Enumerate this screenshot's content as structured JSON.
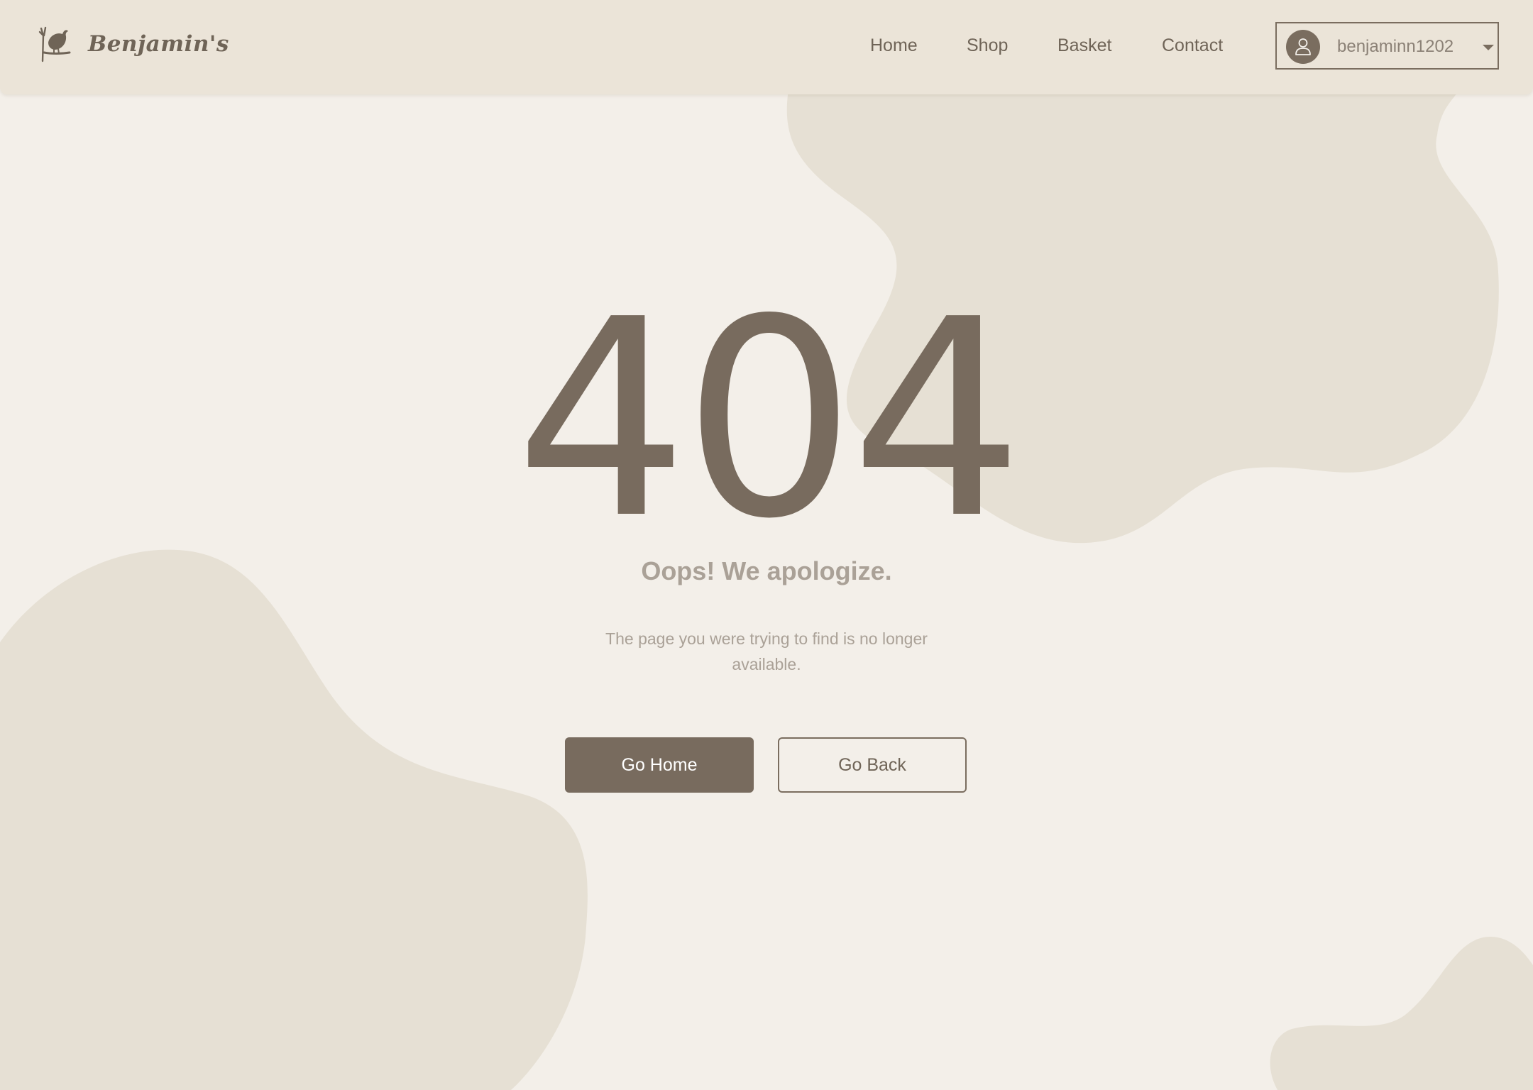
{
  "brand": {
    "name": "Benjamin's",
    "logo_icon": "bird-branch-icon"
  },
  "nav": {
    "items": [
      {
        "label": "Home"
      },
      {
        "label": "Shop"
      },
      {
        "label": "Basket"
      },
      {
        "label": "Contact"
      }
    ]
  },
  "user": {
    "username": "benjaminn1202",
    "avatar_icon": "user-icon",
    "dropdown_icon": "caret-down-icon"
  },
  "error": {
    "code": "404",
    "title": "Oops! We apologize.",
    "message": "The page you were trying to find is no longer available."
  },
  "actions": {
    "home_label": "Go Home",
    "back_label": "Go Back"
  },
  "colors": {
    "background": "#f3efe9",
    "header": "#ebe4d8",
    "blob": "#e6e0d4",
    "primary": "#786b5e",
    "muted_text": "#aaa197"
  }
}
